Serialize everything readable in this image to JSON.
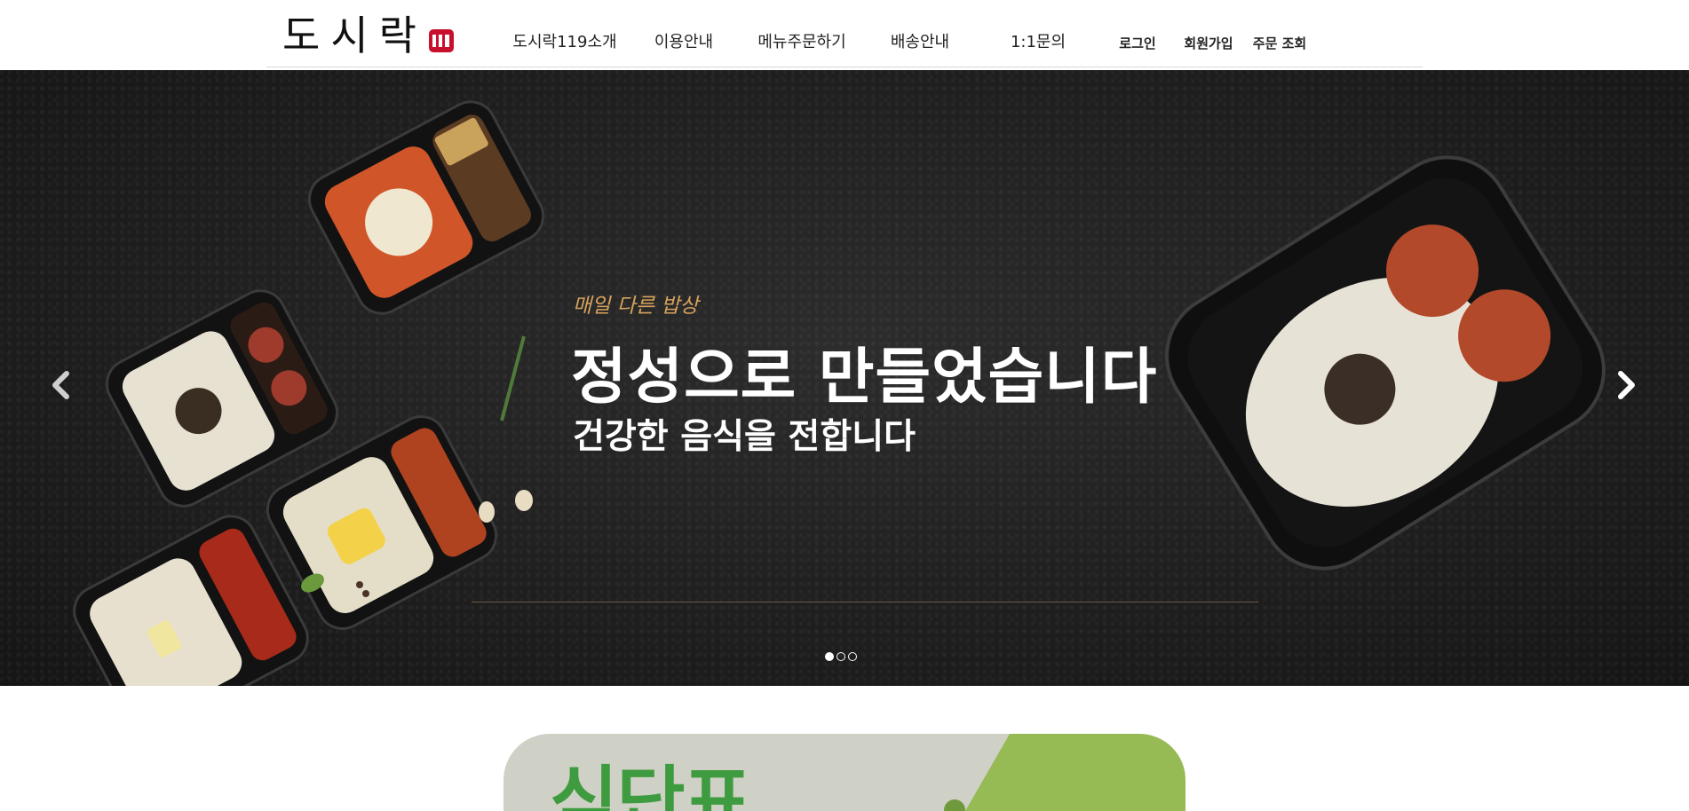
{
  "header": {
    "logo_text": "도시락",
    "logo_mark": "119",
    "nav": [
      {
        "label": "도시락119소개"
      },
      {
        "label": "이용안내"
      },
      {
        "label": "메뉴주문하기"
      },
      {
        "label": "배송안내"
      },
      {
        "label": "1:1문의"
      }
    ],
    "user_links": [
      {
        "label": "로그인"
      },
      {
        "label": "회원가입"
      },
      {
        "label": "주문 조회"
      }
    ]
  },
  "hero": {
    "kicker": "매일 다른 밥상",
    "title": "정성으로 만들었습니다",
    "subtitle": "건강한 음식을 전합니다",
    "prev_icon": "chevron-left-icon",
    "next_icon": "chevron-right-icon",
    "slide_count": 3,
    "active_slide": 1
  },
  "promo": {
    "text": "식단표"
  },
  "colors": {
    "accent_gold": "#d7a35c",
    "brand_red": "#c8102e",
    "promo_green": "#96bb55",
    "promo_text_green": "#3f9b3f"
  }
}
